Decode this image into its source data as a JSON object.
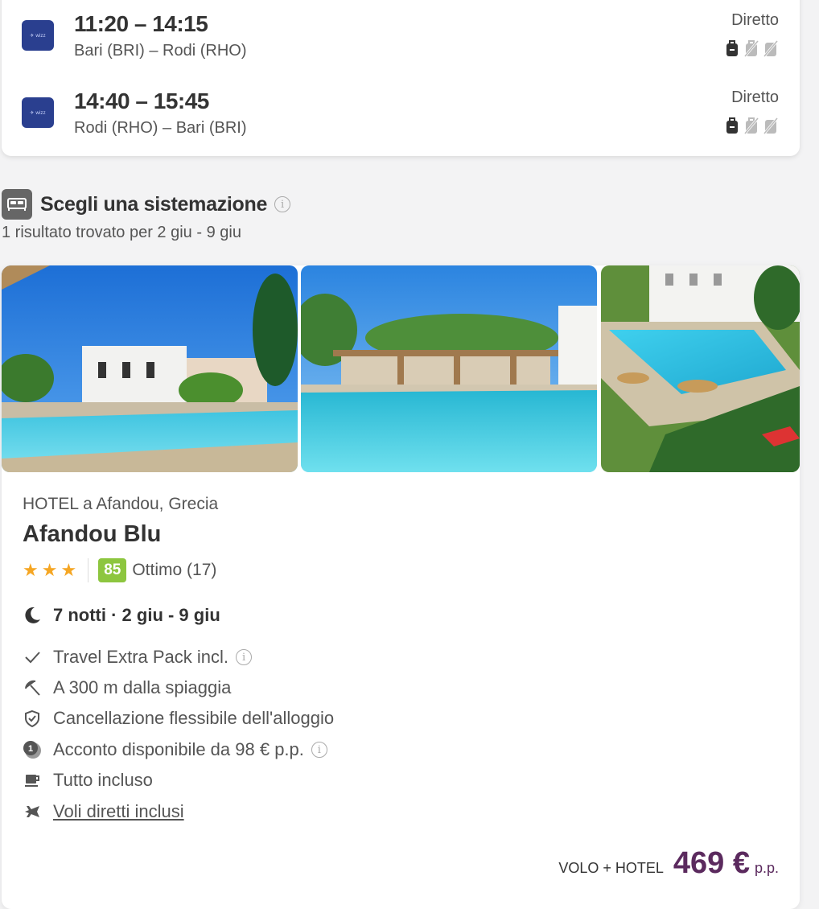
{
  "flights": [
    {
      "time": "11:20 – 14:15",
      "route": "Bari (BRI) – Rodi (RHO)",
      "type": "Diretto",
      "airline_icon": "airline-logo"
    },
    {
      "time": "14:40 – 15:45",
      "route": "Rodi (RHO) – Bari (BRI)",
      "type": "Diretto",
      "airline_icon": "airline-logo"
    }
  ],
  "accommodation": {
    "title": "Scegli una sistemazione",
    "subtitle": "1 risultato trovato per 2 giu - 9 giu"
  },
  "hotel": {
    "type_location": "HOTEL a Afandou, Grecia",
    "name": "Afandou Blu",
    "stars": 3,
    "score": "85",
    "score_label": "Ottimo (17)",
    "nights": "7 notti · 2 giu - 9 giu",
    "features": [
      {
        "icon": "check-icon",
        "text": "Travel Extra Pack incl.",
        "info": true
      },
      {
        "icon": "beach-umbrella-icon",
        "text": "A 300 m dalla spiaggia"
      },
      {
        "icon": "shield-check-icon",
        "text": "Cancellazione flessibile dell'alloggio"
      },
      {
        "icon": "deposit-coin-icon",
        "text": "Acconto disponibile da 98 € p.p.",
        "info": true
      },
      {
        "icon": "cup-icon",
        "text": "Tutto incluso"
      },
      {
        "icon": "airplane-icon",
        "text": "Voli diretti inclusi",
        "link": true
      }
    ],
    "price_label": "VOLO + HOTEL",
    "price": "469 €",
    "price_suffix": "p.p."
  },
  "colors": {
    "price": "#5b2a5e",
    "score_bg": "#8dc63f",
    "star": "#f5a623",
    "airline": "#2a3f8f"
  }
}
